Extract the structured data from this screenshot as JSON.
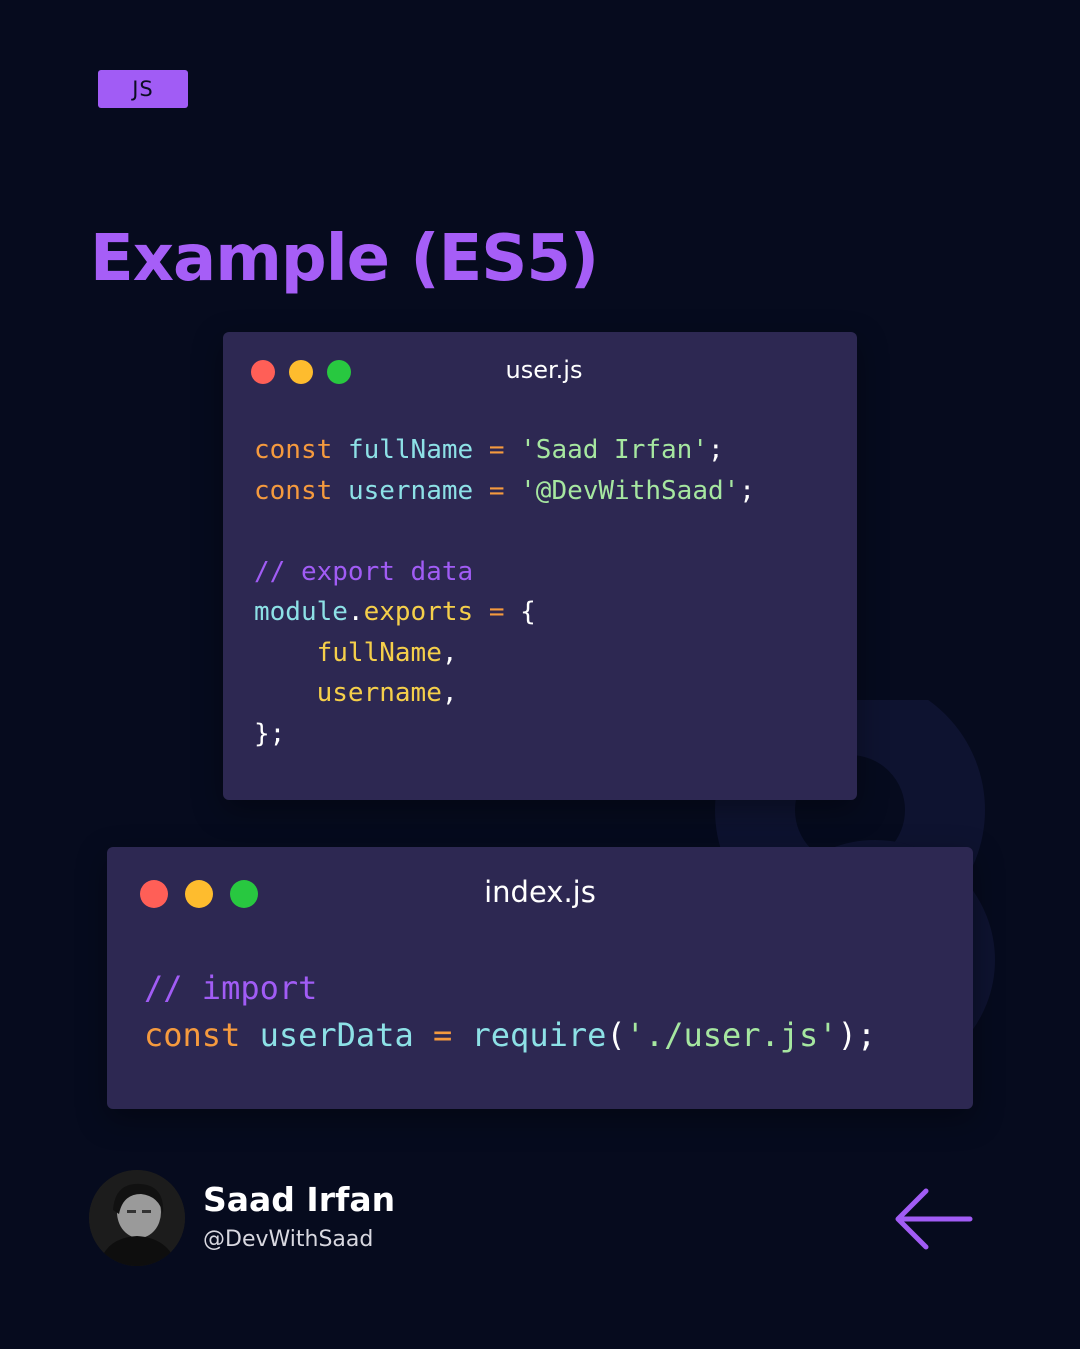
{
  "tag": {
    "label": "JS"
  },
  "title": "Example (ES5)",
  "colors": {
    "background": "#060b1e",
    "accent": "#a15cf5",
    "window": "#2d2852"
  },
  "windows": [
    {
      "filename": "user.js",
      "code": {
        "line1": {
          "kw": "const",
          "var": "fullName",
          "op": "=",
          "str": "'Saad Irfan'",
          "end": ";"
        },
        "line2": {
          "kw": "const",
          "var": "username",
          "op": "=",
          "str": "'@DevWithSaad'",
          "end": ";"
        },
        "line3": {
          "comment": "// export data"
        },
        "line4": {
          "obj": "module",
          "dot": ".",
          "prop": "exports",
          "op": "=",
          "brace": "{"
        },
        "line5": {
          "prop": "fullName",
          "comma": ","
        },
        "line6": {
          "prop": "username",
          "comma": ","
        },
        "line7": {
          "close": "};"
        }
      }
    },
    {
      "filename": "index.js",
      "code": {
        "line1": {
          "comment": "// import"
        },
        "line2": {
          "kw": "const",
          "var": "userData",
          "op": "=",
          "fn": "require",
          "open": "(",
          "str": "'./user.js'",
          "close": ");"
        }
      }
    }
  ],
  "author": {
    "name": "Saad Irfan",
    "handle": "@DevWithSaad"
  },
  "icons": {
    "traffic": [
      "close-dot",
      "minimize-dot",
      "maximize-dot"
    ],
    "nav": "arrow-left-icon"
  }
}
